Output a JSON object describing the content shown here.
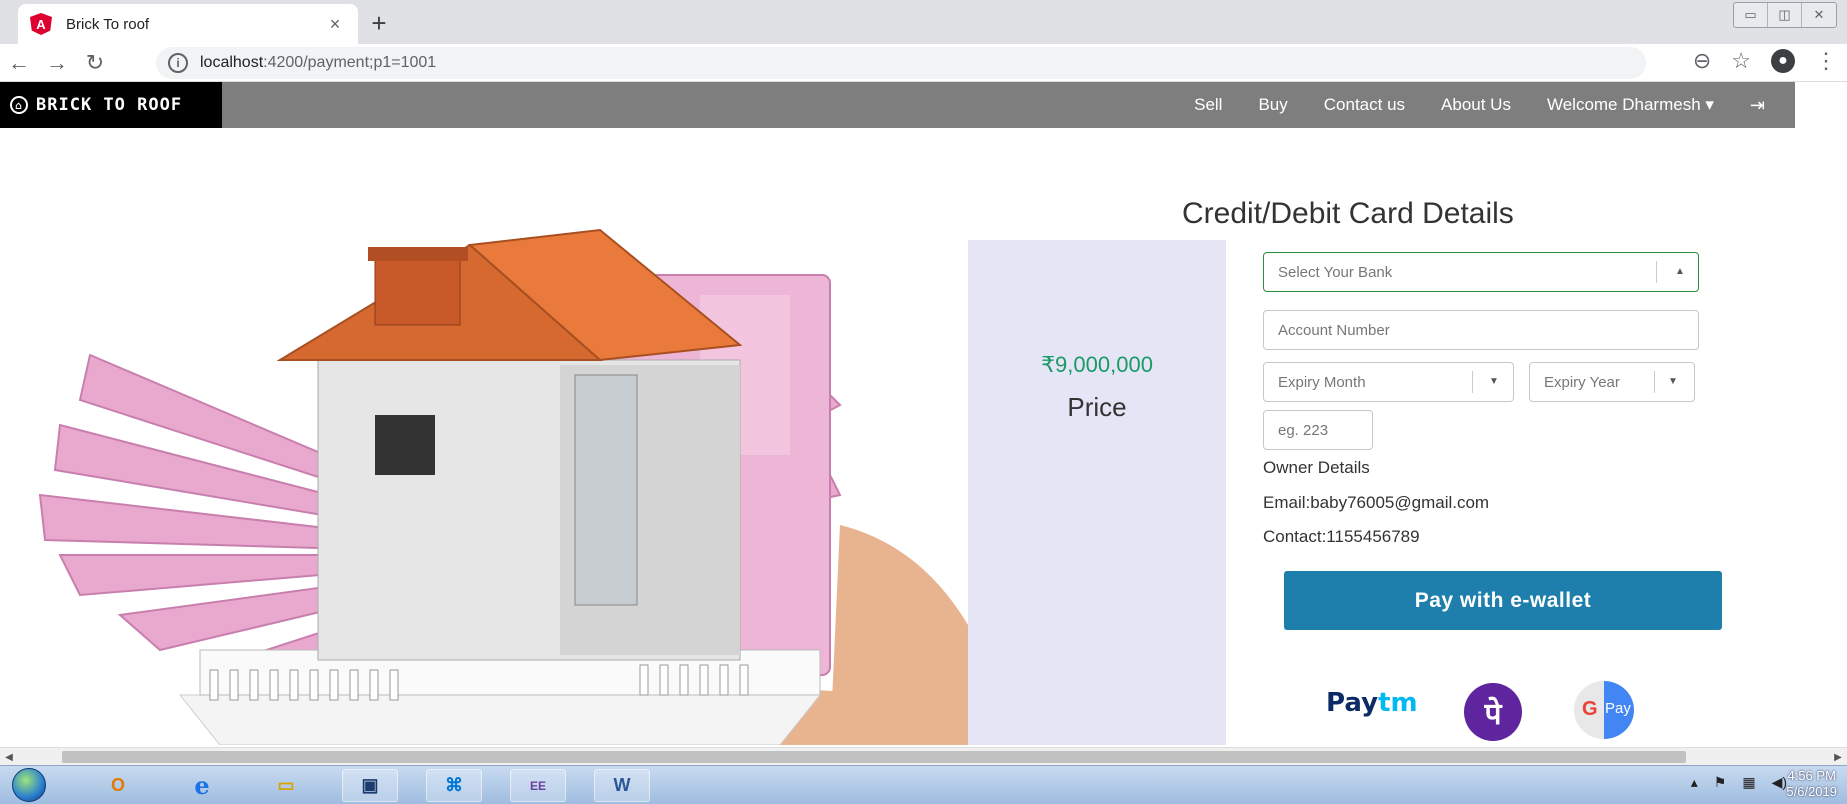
{
  "browser": {
    "tab_title": "Brick To roof",
    "tab_close": "×",
    "new_tab": "+",
    "url_host": "localhost",
    "url_path": ":4200/payment;p1=1001"
  },
  "navbar": {
    "brand": "BRICK TO ROOF",
    "links": [
      "Sell",
      "Buy",
      "Contact us",
      "About Us",
      "Welcome Dharmesh ▾"
    ]
  },
  "payment": {
    "title": "Credit/Debit Card Details",
    "price": "₹9,000,000",
    "price_label": "Price",
    "bank_placeholder": "Select Your Bank",
    "account_placeholder": "Account Number",
    "expiry_month_placeholder": "Expiry Month",
    "expiry_year_placeholder": "Expiry Year",
    "cvv_placeholder": "eg. 223",
    "owner_heading": "Owner Details",
    "owner_email": "Email:baby76005@gmail.com",
    "owner_contact": "Contact:1155456789",
    "pay_button": "Pay with e-wallet"
  },
  "wallets": {
    "paytm_a": "Pay",
    "paytm_b": "tm",
    "phonepe": "पे",
    "gpay_g": "G",
    "gpay_pay": "Pay"
  },
  "taskbar": {
    "apps": [
      {
        "id": "outlook",
        "glyph": "O"
      },
      {
        "id": "ie",
        "glyph": "e"
      },
      {
        "id": "explorer",
        "glyph": "▭"
      },
      {
        "id": "screen",
        "glyph": "▣"
      },
      {
        "id": "vscode",
        "glyph": "⌘"
      },
      {
        "id": "eclipse",
        "glyph": "EE"
      },
      {
        "id": "word",
        "glyph": "W"
      }
    ],
    "time": "4:56 PM",
    "date": "5/6/2019"
  },
  "colors": {
    "navbar": "#7e7e7e",
    "price": "#1a9b66",
    "pay_button": "#1e7fac",
    "price_panel": "#e6e5f6"
  }
}
